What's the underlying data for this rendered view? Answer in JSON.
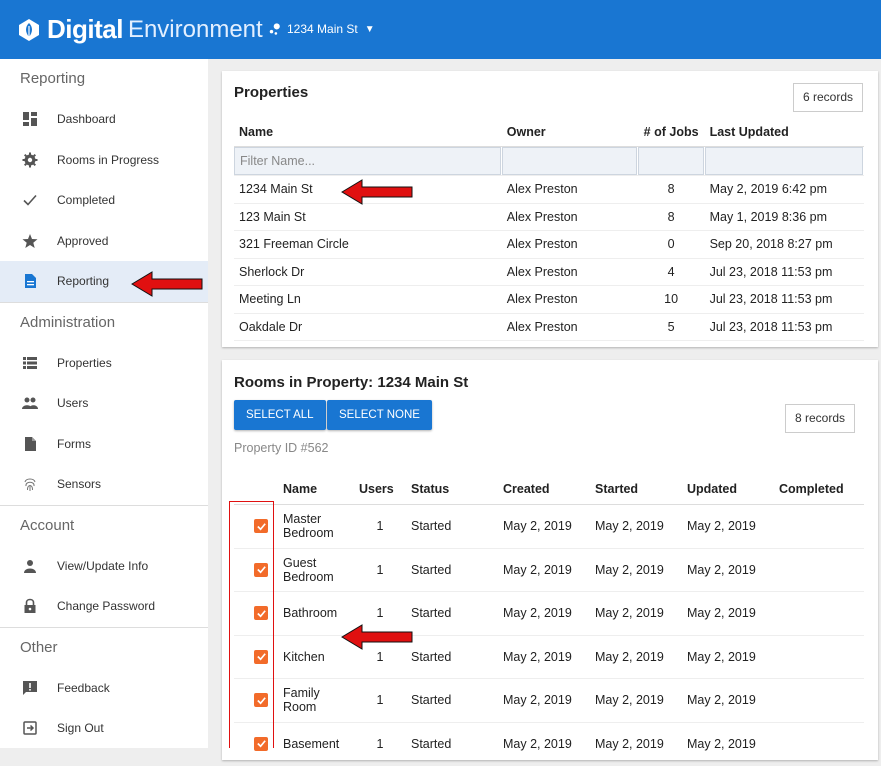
{
  "header": {
    "brand_bold": "Digital",
    "brand_light": "Environment",
    "property_selector": "1234 Main St",
    "bg_color": "#1976d2"
  },
  "sidebar": {
    "sections": [
      {
        "title": "Reporting",
        "items": [
          {
            "label": "Dashboard",
            "icon": "dashboard-icon"
          },
          {
            "label": "Rooms in Progress",
            "icon": "gear-icon"
          },
          {
            "label": "Completed",
            "icon": "check-icon"
          },
          {
            "label": "Approved",
            "icon": "star-icon"
          },
          {
            "label": "Reporting",
            "icon": "document-icon",
            "active": true
          }
        ]
      },
      {
        "title": "Administration",
        "items": [
          {
            "label": "Properties",
            "icon": "list-icon"
          },
          {
            "label": "Users",
            "icon": "users-icon"
          },
          {
            "label": "Forms",
            "icon": "file-icon"
          },
          {
            "label": "Sensors",
            "icon": "fingerprint-icon"
          }
        ]
      },
      {
        "title": "Account",
        "items": [
          {
            "label": "View/Update Info",
            "icon": "person-icon"
          },
          {
            "label": "Change Password",
            "icon": "lock-icon"
          }
        ]
      },
      {
        "title": "Other",
        "items": [
          {
            "label": "Feedback",
            "icon": "feedback-icon"
          },
          {
            "label": "Sign Out",
            "icon": "sign-out-icon"
          }
        ]
      }
    ]
  },
  "properties": {
    "title": "Properties",
    "records": "6 records",
    "columns": [
      "Name",
      "Owner",
      "# of Jobs",
      "Last Updated"
    ],
    "filter_placeholder": "Filter Name...",
    "rows": [
      [
        "1234 Main St",
        "Alex Preston",
        "8",
        "May 2, 2019 6:42 pm"
      ],
      [
        "123 Main St",
        "Alex Preston",
        "8",
        "May 1, 2019 8:36 pm"
      ],
      [
        "321 Freeman Circle",
        "Alex Preston",
        "0",
        "Sep 20, 2018 8:27 pm"
      ],
      [
        "Sherlock Dr",
        "Alex Preston",
        "4",
        "Jul 23, 2018 11:53 pm"
      ],
      [
        "Meeting Ln",
        "Alex Preston",
        "10",
        "Jul 23, 2018 11:53 pm"
      ],
      [
        "Oakdale Dr",
        "Alex Preston",
        "5",
        "Jul 23, 2018 11:53 pm"
      ]
    ]
  },
  "rooms": {
    "title": "Rooms in Property: 1234 Main St",
    "select_all": "SELECT ALL",
    "select_none": "SELECT NONE",
    "records": "8 records",
    "property_id": "Property ID #562",
    "columns": [
      "",
      "Name",
      "Users",
      "Status",
      "Created",
      "Started",
      "Updated",
      "Completed"
    ],
    "rows": [
      {
        "name": "Master Bedroom",
        "users": "1",
        "status": "Started",
        "created": "May 2, 2019",
        "started": "May 2, 2019",
        "updated": "May 2, 2019",
        "completed": "",
        "checked": true
      },
      {
        "name": "Guest Bedroom",
        "users": "1",
        "status": "Started",
        "created": "May 2, 2019",
        "started": "May 2, 2019",
        "updated": "May 2, 2019",
        "completed": "",
        "checked": true
      },
      {
        "name": "Bathroom",
        "users": "1",
        "status": "Started",
        "created": "May 2, 2019",
        "started": "May 2, 2019",
        "updated": "May 2, 2019",
        "completed": "",
        "checked": true
      },
      {
        "name": "Kitchen",
        "users": "1",
        "status": "Started",
        "created": "May 2, 2019",
        "started": "May 2, 2019",
        "updated": "May 2, 2019",
        "completed": "",
        "checked": true
      },
      {
        "name": "Family Room",
        "users": "1",
        "status": "Started",
        "created": "May 2, 2019",
        "started": "May 2, 2019",
        "updated": "May 2, 2019",
        "completed": "",
        "checked": true
      },
      {
        "name": "Basement",
        "users": "1",
        "status": "Started",
        "created": "May 2, 2019",
        "started": "May 2, 2019",
        "updated": "May 2, 2019",
        "completed": "",
        "checked": true
      }
    ],
    "checkbox_color": "#f26b2a"
  },
  "annotations": {
    "arrow_color": "#e01010"
  }
}
